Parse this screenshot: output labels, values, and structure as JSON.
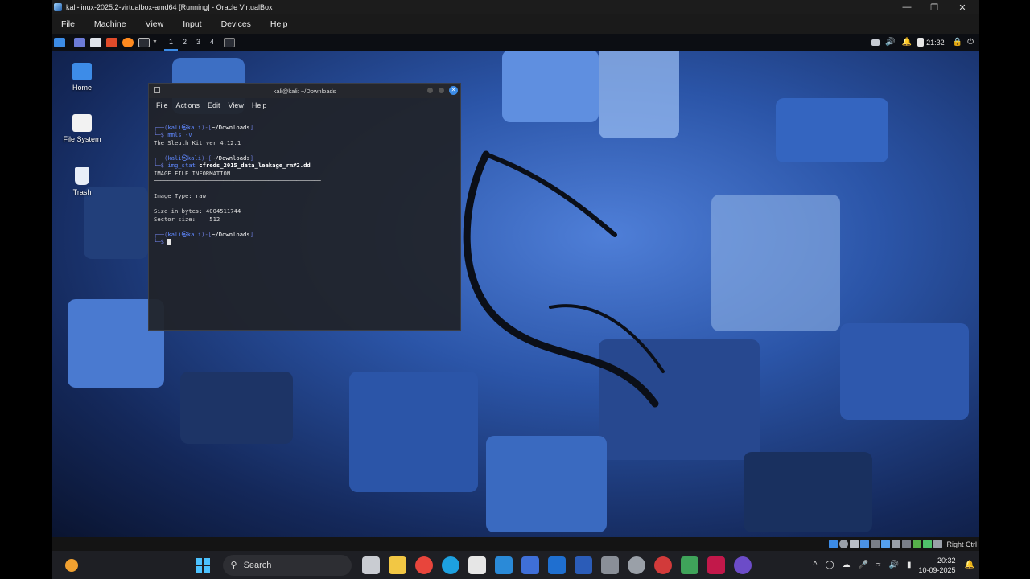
{
  "vbox": {
    "title": "kali-linux-2025.2-virtualbox-amd64 [Running] - Oracle VirtualBox",
    "menu": [
      "File",
      "Machine",
      "View",
      "Input",
      "Devices",
      "Help"
    ],
    "host_key": "Right Ctrl"
  },
  "kali": {
    "workspaces": [
      "1",
      "2",
      "3",
      "4"
    ],
    "clock": "21:32",
    "desktop_icons": [
      {
        "label": "Home",
        "icon": "home-folder-icon"
      },
      {
        "label": "File System",
        "icon": "drive-icon"
      },
      {
        "label": "Trash",
        "icon": "trash-icon"
      }
    ]
  },
  "terminal": {
    "title": "kali@kali: ~/Downloads",
    "menu": [
      "File",
      "Actions",
      "Edit",
      "View",
      "Help"
    ],
    "prompt_user": "kali㉿kali",
    "prompt_dir": "~/Downloads",
    "lines": {
      "cmd1": "mmls -V",
      "out1": "The Sleuth Kit ver 4.12.1",
      "cmd2_name": "img_stat",
      "cmd2_arg": "cfreds_2015_data_leakage_rm#2.dd",
      "out2_heading": "IMAGE FILE INFORMATION",
      "out2_rule": "────────────────────────────────────────────────",
      "out2_type": "Image Type: raw",
      "out2_size": "Size in bytes: 4004511744",
      "out2_sector": "Sector size:    512"
    }
  },
  "taskbar": {
    "search_placeholder": "Search",
    "time": "20:32",
    "date": "10-09-2025"
  }
}
